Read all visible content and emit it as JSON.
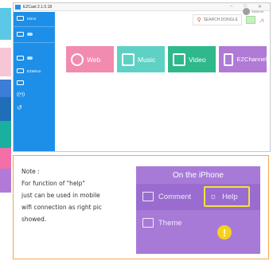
{
  "window": {
    "title": "EZCast 2.1.0.18",
    "controls": [
      "–",
      "□",
      "✕"
    ]
  },
  "sidebar": {
    "items": [
      {
        "label": "Mirror",
        "icon": "mirror-icon"
      },
      {
        "label": "",
        "icon": "projector-icon",
        "toggle": true
      },
      {
        "label": "",
        "icon": "speaker-icon",
        "toggle": true
      },
      {
        "label": "EZMirror",
        "icon": "ezmirror-icon"
      },
      {
        "label": "",
        "icon": "monitor-icon"
      },
      {
        "label": "",
        "icon": "wireless-icon"
      },
      {
        "label": "",
        "icon": "refresh-icon"
      }
    ]
  },
  "toolbar": {
    "search_label": "SEARCH DONGLE",
    "sign_in": "SIGN IN"
  },
  "tiles": [
    {
      "label": "Web",
      "color": "#f28bb0",
      "icon": "globe-icon"
    },
    {
      "label": "Music",
      "color": "#5fd1c4",
      "icon": "music-icon"
    },
    {
      "label": "Video",
      "color": "#2fb88c",
      "icon": "film-icon"
    },
    {
      "label": "EZChannel",
      "color": "#b07ad6",
      "icon": "tv-icon"
    }
  ],
  "note": {
    "lines": [
      "Note :",
      "For function of \"help\"",
      "just can be used in mobile",
      "wifi connection as right pic",
      "showed."
    ]
  },
  "phone": {
    "header": "On the iPhone",
    "items": [
      {
        "label": "Comment",
        "icon": "comment-icon"
      },
      {
        "label": "Help",
        "icon": "bulb-icon"
      },
      {
        "label": "Theme",
        "icon": "image-icon"
      }
    ],
    "warning_mark": "!"
  },
  "colors": {
    "sidebar": "#1e8fe8",
    "note_border": "#f3a54b",
    "phone_bg": "#a77ad8",
    "highlight": "#f6e23a"
  }
}
